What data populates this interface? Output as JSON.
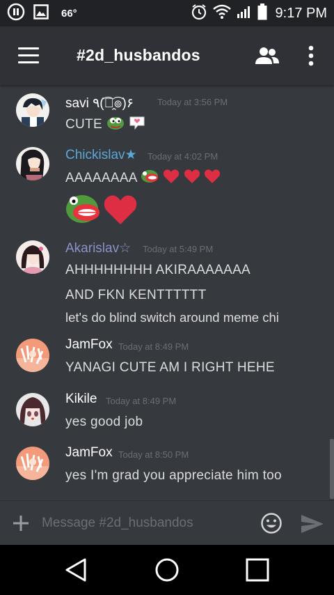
{
  "status_bar": {
    "temperature": "66°",
    "time": "9:17 PM",
    "icons": [
      "notification-icon",
      "image-icon",
      "alarm-icon",
      "wifi-icon",
      "signal-icon",
      "battery-icon"
    ]
  },
  "header": {
    "title": "#2d_husbandos",
    "menu_icon": "hamburger-menu-icon",
    "members_icon": "members-icon",
    "more_icon": "more-vertical-icon"
  },
  "messages": [
    {
      "author": "savi ٩(͡๏̯͡๏)۶",
      "author_color": "#ffffff",
      "timestamp": "Today at 3:56 PM",
      "lines": [
        "CUTE"
      ],
      "emojis": [
        "pepe-icon",
        "love-letter-icon"
      ]
    },
    {
      "author": "Chickislav★",
      "author_color": "#5aa8d6",
      "timestamp": "Today at 4:02 PM",
      "lines": [
        "AAAAAAAA"
      ],
      "emojis": [
        "pepe-scream-icon",
        "heart-icon",
        "heart-icon",
        "heart-icon",
        "large-pepe-scream-icon",
        "large-heart-icon"
      ]
    },
    {
      "author": "Akarislav☆",
      "author_color": "#8b93c9",
      "timestamp": "Today at 5:49 PM",
      "lines": [
        "AHHHHHHHH AKIRAAAAAAA",
        "AND FKN KENTTTTTT",
        "let's do blind switch around meme chi"
      ]
    },
    {
      "author": "JamFox",
      "author_color": "#ffffff",
      "timestamp": "Today at 8:49 PM",
      "lines": [
        "YANAGI CUTE AM I RIGHT HEHE"
      ]
    },
    {
      "author": "Kikile",
      "author_color": "#ffffff",
      "timestamp": "Today at 8:49 PM",
      "lines": [
        "yes good job"
      ]
    },
    {
      "author": "JamFox",
      "author_color": "#ffffff",
      "timestamp": "Today at 8:50 PM",
      "lines": [
        "yes I'm grad you appreciate him too"
      ]
    }
  ],
  "composer": {
    "placeholder": "Message #2d_husbandos",
    "value": "",
    "plus_icon": "plus-icon",
    "emoji_icon": "smiley-icon",
    "send_icon": "send-icon"
  },
  "nav_bar": {
    "icons": [
      "back-icon",
      "home-icon",
      "recents-icon"
    ]
  },
  "colors": {
    "background": "#36393e",
    "header": "#2f3136",
    "status_bar": "#202225",
    "timestamp": "#6b6e74",
    "heart": "#dd2e44"
  }
}
